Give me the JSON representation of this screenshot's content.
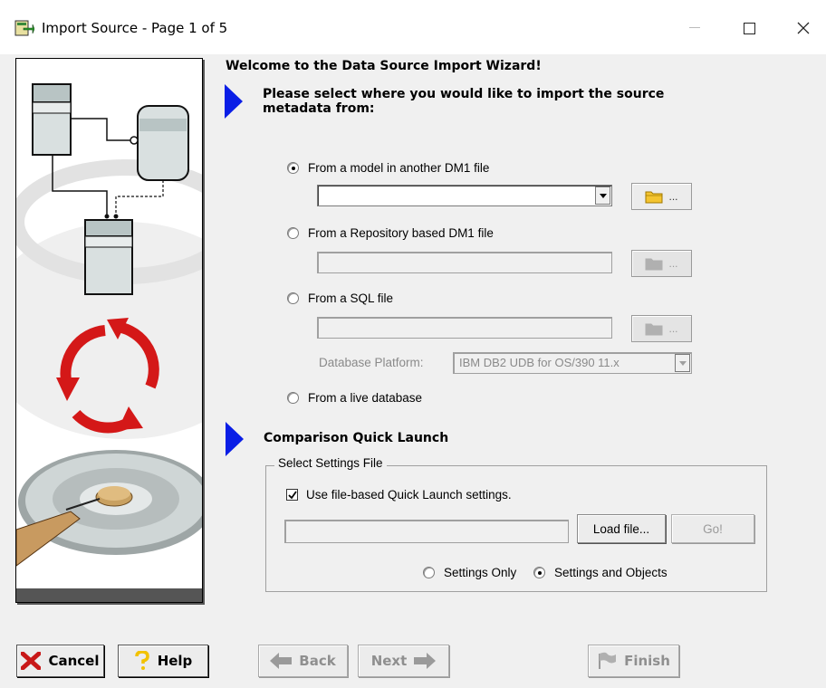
{
  "window": {
    "title": "Import Source - Page 1 of 5",
    "icon": "import-wizard-icon"
  },
  "wizard": {
    "welcome": "Welcome to the Data Source Import Wizard!",
    "prompt": "Please select where you would like to import the source metadata from:",
    "options": {
      "model_dm1": {
        "label": "From a model in another DM1 file",
        "selected": true,
        "value": ""
      },
      "repo_dm1": {
        "label": "From a Repository based DM1 file",
        "selected": false,
        "value": ""
      },
      "sql_file": {
        "label": "From a SQL file",
        "selected": false,
        "value": ""
      },
      "live_db": {
        "label": "From a live database",
        "selected": false
      }
    },
    "browse_label": "...",
    "database_platform": {
      "label": "Database Platform:",
      "value": "IBM DB2 UDB for OS/390 11.x"
    }
  },
  "quick_launch": {
    "heading": "Comparison Quick Launch",
    "group_label": "Select Settings File",
    "use_file_label": "Use file-based Quick Launch settings.",
    "use_file_checked": true,
    "file_value": "",
    "load_file_label": "Load file...",
    "go_label": "Go!",
    "settings_only_label": "Settings Only",
    "settings_only_selected": false,
    "settings_objects_label": "Settings and Objects",
    "settings_objects_selected": true
  },
  "footer": {
    "cancel": "Cancel",
    "help": "Help",
    "back": "Back",
    "next": "Next",
    "finish": "Finish"
  },
  "colors": {
    "arrow_blue": "#0a1ee6",
    "cancel_red": "#c81818",
    "help_yellow": "#f2c200",
    "folder_yellow": "#f4c430"
  }
}
